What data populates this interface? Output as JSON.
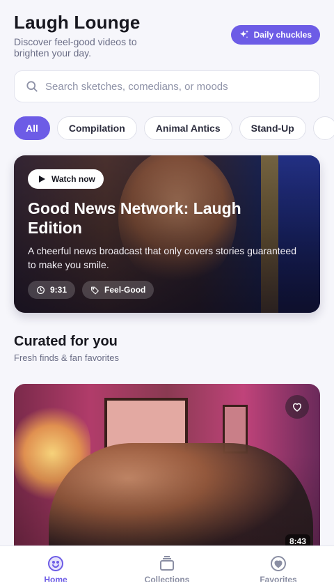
{
  "app": {
    "title": "Laugh Lounge",
    "subtitle": "Discover feel-good videos to brighten your day.",
    "daily_label": "Daily chuckles"
  },
  "search": {
    "placeholder": "Search sketches, comedians, or moods",
    "value": ""
  },
  "chips": [
    {
      "label": "All",
      "active": true
    },
    {
      "label": "Compilation",
      "active": false
    },
    {
      "label": "Animal Antics",
      "active": false
    },
    {
      "label": "Stand-Up",
      "active": false
    }
  ],
  "featured": {
    "watch_label": "Watch now",
    "title": "Good News Network: Laugh Edition",
    "description": "A cheerful news broadcast that only covers stories guaranteed to make you smile.",
    "duration": "9:31",
    "tag": "Feel-Good"
  },
  "curated": {
    "title": "Curated for you",
    "subtitle": "Fresh finds & fan favorites",
    "cards": [
      {
        "duration": "8:43",
        "favorite_icon": "heart-icon"
      }
    ]
  },
  "tabbar": {
    "items": [
      {
        "label": "Home",
        "icon": "smile-icon",
        "active": true
      },
      {
        "label": "Collections",
        "icon": "collections-icon",
        "active": false
      },
      {
        "label": "Favorites",
        "icon": "heart-icon",
        "active": false
      }
    ]
  },
  "colors": {
    "accent": "#6d5ce6",
    "background": "#f6f6fb",
    "muted_text": "#6a6d86"
  }
}
